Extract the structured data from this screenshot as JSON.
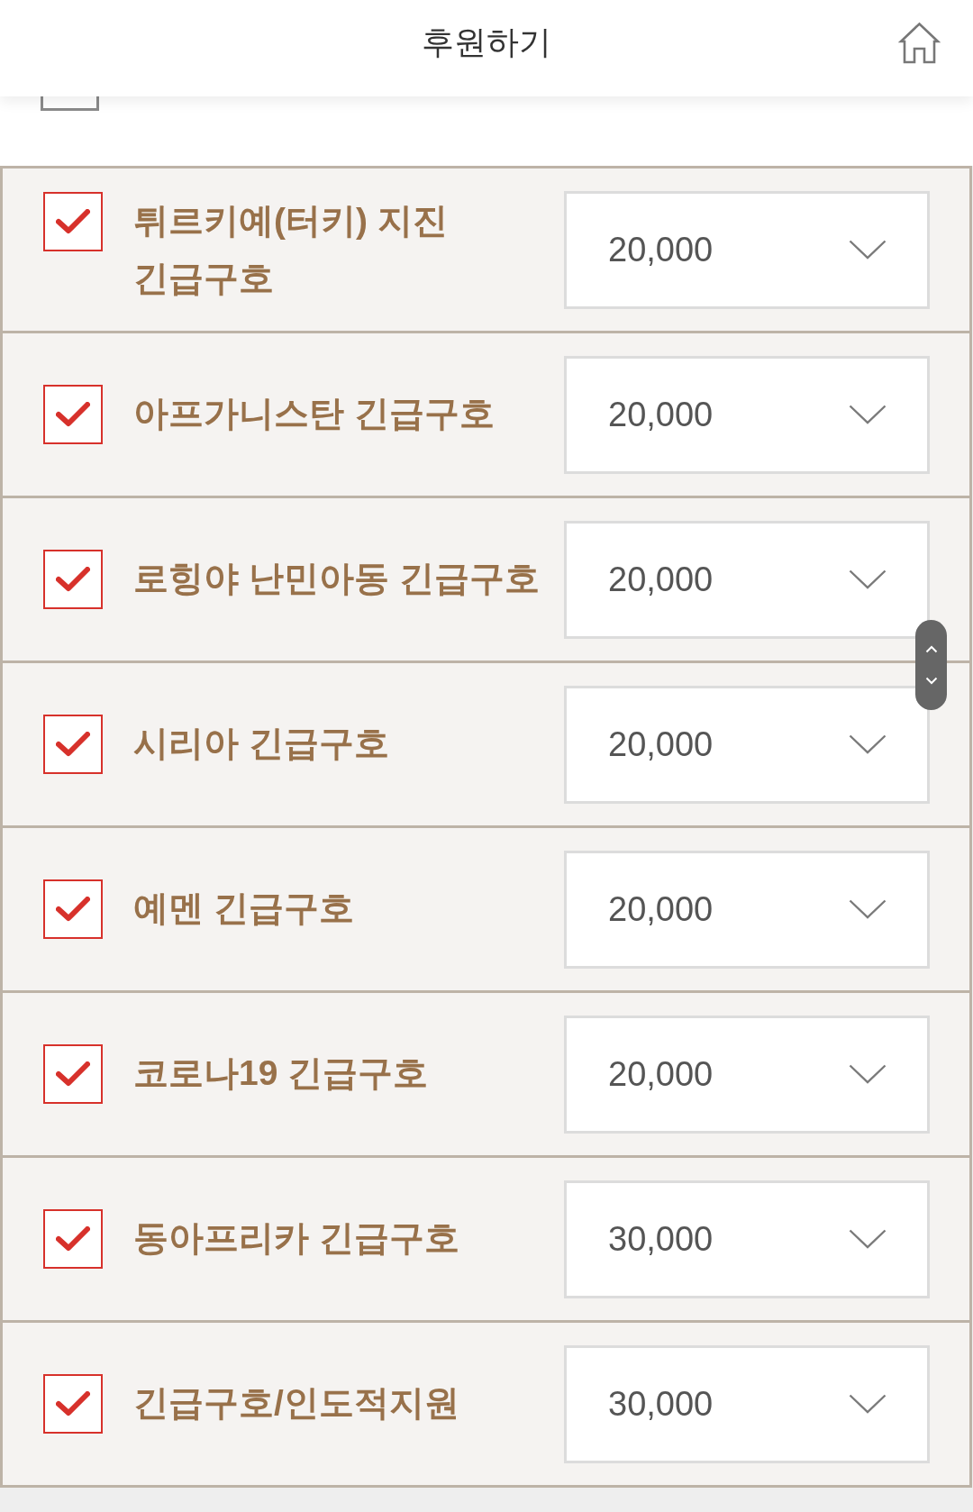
{
  "header": {
    "title": "후원하기"
  },
  "scrolled_item": {
    "checked": false
  },
  "items": [
    {
      "name": "튀르키예(터키) 지진 긴급구호",
      "checked": true,
      "amount": "20,000"
    },
    {
      "name": "아프가니스탄 긴급구호",
      "checked": true,
      "amount": "20,000"
    },
    {
      "name": "로힝야 난민아동 긴급구호",
      "checked": true,
      "amount": "20,000"
    },
    {
      "name": "시리아 긴급구호",
      "checked": true,
      "amount": "20,000"
    },
    {
      "name": "예멘 긴급구호",
      "checked": true,
      "amount": "20,000"
    },
    {
      "name": "코로나19 긴급구호",
      "checked": true,
      "amount": "20,000"
    },
    {
      "name": "동아프리카 긴급구호",
      "checked": true,
      "amount": "30,000"
    },
    {
      "name": "긴급구호/인도적지원",
      "checked": true,
      "amount": "30,000"
    }
  ]
}
